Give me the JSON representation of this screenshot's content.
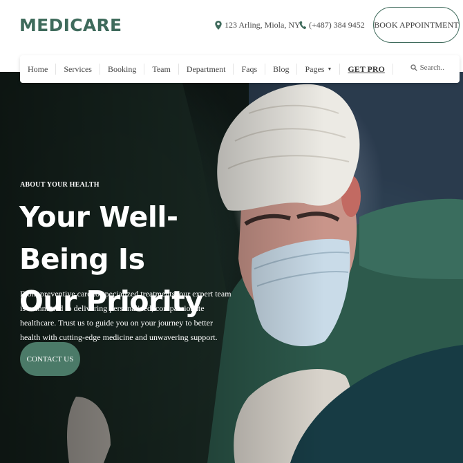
{
  "brand": {
    "name": "MEDICARE",
    "color": "#3f6b5c"
  },
  "header": {
    "address": "123 Arling, Miola, NY",
    "address_icon": "map-pin-icon",
    "phone": "(+487) 384 9452",
    "phone_icon": "phone-icon",
    "book_button": "BOOK APPOINTMENT"
  },
  "nav": {
    "items": [
      {
        "label": "Home"
      },
      {
        "label": "Services"
      },
      {
        "label": "Booking"
      },
      {
        "label": "Team"
      },
      {
        "label": "Department"
      },
      {
        "label": "Faqs"
      },
      {
        "label": "Blog"
      },
      {
        "label": "Pages"
      },
      {
        "label": "GET PRO"
      }
    ],
    "pages_caret_icon": "caret-down-icon",
    "search_placeholder": "Search..",
    "search_icon": "search-icon"
  },
  "hero": {
    "eyebrow": "ABOUT YOUR HEALTH",
    "title_line1": "Your Well-Being Is",
    "title_line2": "Our Priority",
    "description": "From preventive care to specialized treatments, our expert team is committed to delivering personalized, compassionate healthcare. Trust us to guide you on your journey to better health with cutting-edge medicine and unwavering support.",
    "cta": "CONTACT US",
    "accent": "#4b7a68"
  }
}
